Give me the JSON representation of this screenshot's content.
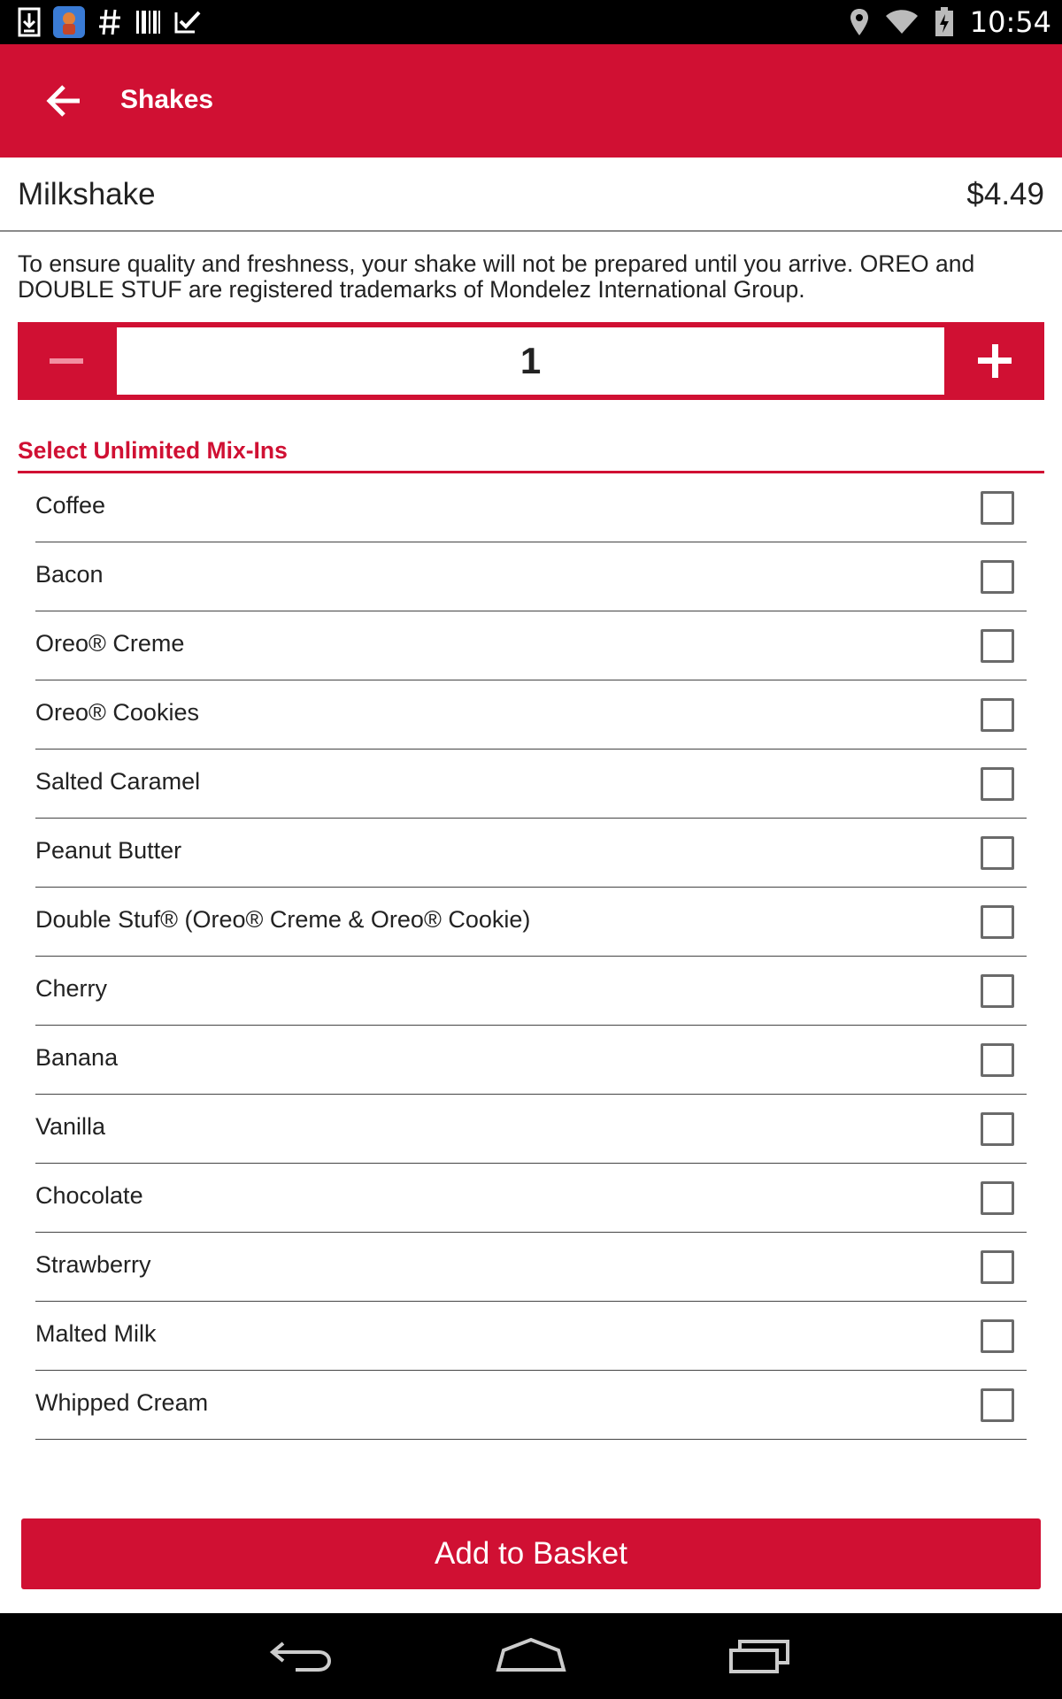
{
  "status_bar": {
    "time": "10:54",
    "left_icons": [
      "download-icon",
      "app-notification-icon",
      "hashtag-icon",
      "barcode-icon",
      "checkmark-icon"
    ],
    "right_icons": [
      "location-icon",
      "wifi-icon",
      "battery-icon"
    ]
  },
  "app_bar": {
    "back_icon": "arrow-left-icon",
    "title": "Shakes",
    "color": "#d01033"
  },
  "product": {
    "name": "Milkshake",
    "price": "$4.49",
    "description": "To ensure quality and freshness, your shake will not be prepared until you arrive. OREO and DOUBLE STUF are registered trademarks of Mondelez International Group."
  },
  "quantity": {
    "value": "1",
    "minus_icon": "minus-icon",
    "plus_icon": "plus-icon"
  },
  "mixins": {
    "heading": "Select Unlimited Mix-Ins",
    "items": [
      {
        "label": "Coffee",
        "checked": false
      },
      {
        "label": "Bacon",
        "checked": false
      },
      {
        "label": "Oreo® Creme",
        "checked": false
      },
      {
        "label": "Oreo® Cookies",
        "checked": false
      },
      {
        "label": "Salted Caramel",
        "checked": false
      },
      {
        "label": "Peanut Butter",
        "checked": false
      },
      {
        "label": "Double Stuf® (Oreo® Creme & Oreo® Cookie)",
        "checked": false
      },
      {
        "label": "Cherry",
        "checked": false
      },
      {
        "label": "Banana",
        "checked": false
      },
      {
        "label": "Vanilla",
        "checked": false
      },
      {
        "label": "Chocolate",
        "checked": false
      },
      {
        "label": "Strawberry",
        "checked": false
      },
      {
        "label": "Malted Milk",
        "checked": false
      },
      {
        "label": "Whipped Cream",
        "checked": false
      }
    ]
  },
  "actions": {
    "add_to_basket": "Add to Basket"
  },
  "nav_bar": {
    "icons": [
      "back-nav-icon",
      "home-nav-icon",
      "recents-nav-icon"
    ]
  }
}
